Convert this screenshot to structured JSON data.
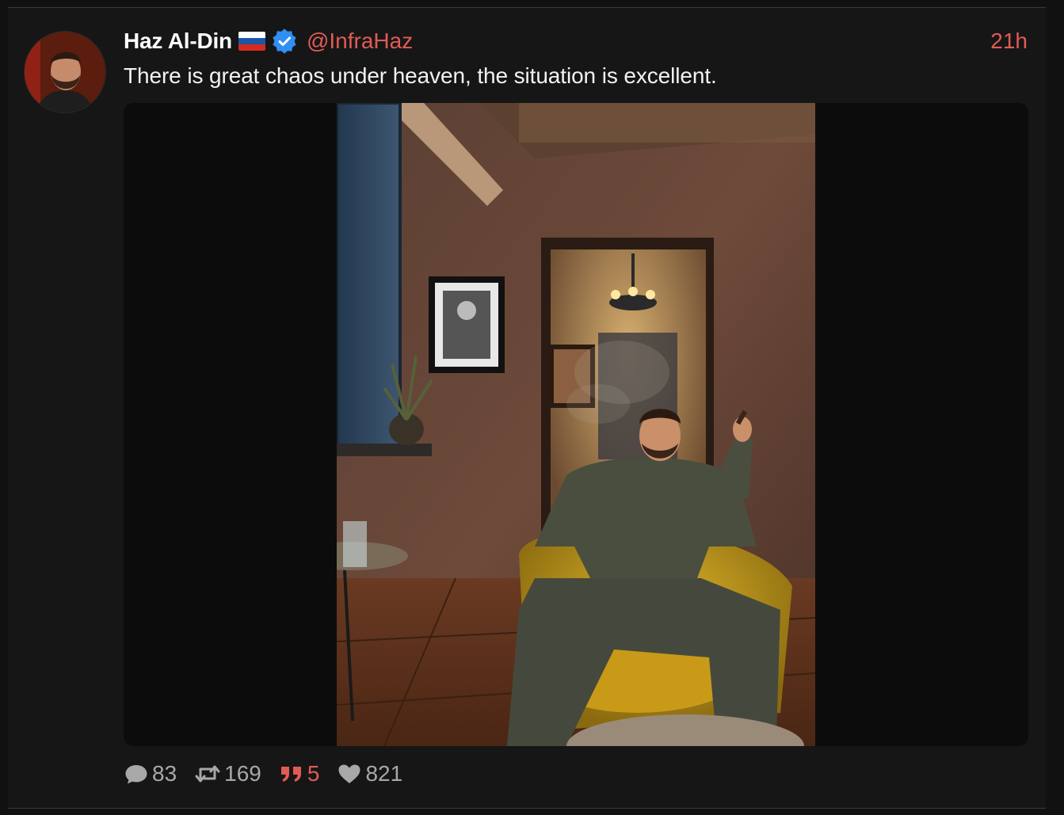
{
  "post": {
    "author_name": "Haz Al-Din",
    "flag_icon": "russia-flag-icon",
    "verified_icon": "verified-badge-icon",
    "handle": "@InfraHaz",
    "timestamp": "21h",
    "text": "There is great chaos under heaven, the situation is excellent.",
    "accent_color": "#e15b55"
  },
  "actions": {
    "comments": {
      "icon": "comment-icon",
      "count": "83"
    },
    "reposts": {
      "icon": "repost-icon",
      "count": "169"
    },
    "quotes": {
      "icon": "quote-icon",
      "count": "5",
      "color": "#e15b55"
    },
    "likes": {
      "icon": "heart-icon",
      "count": "821"
    }
  }
}
